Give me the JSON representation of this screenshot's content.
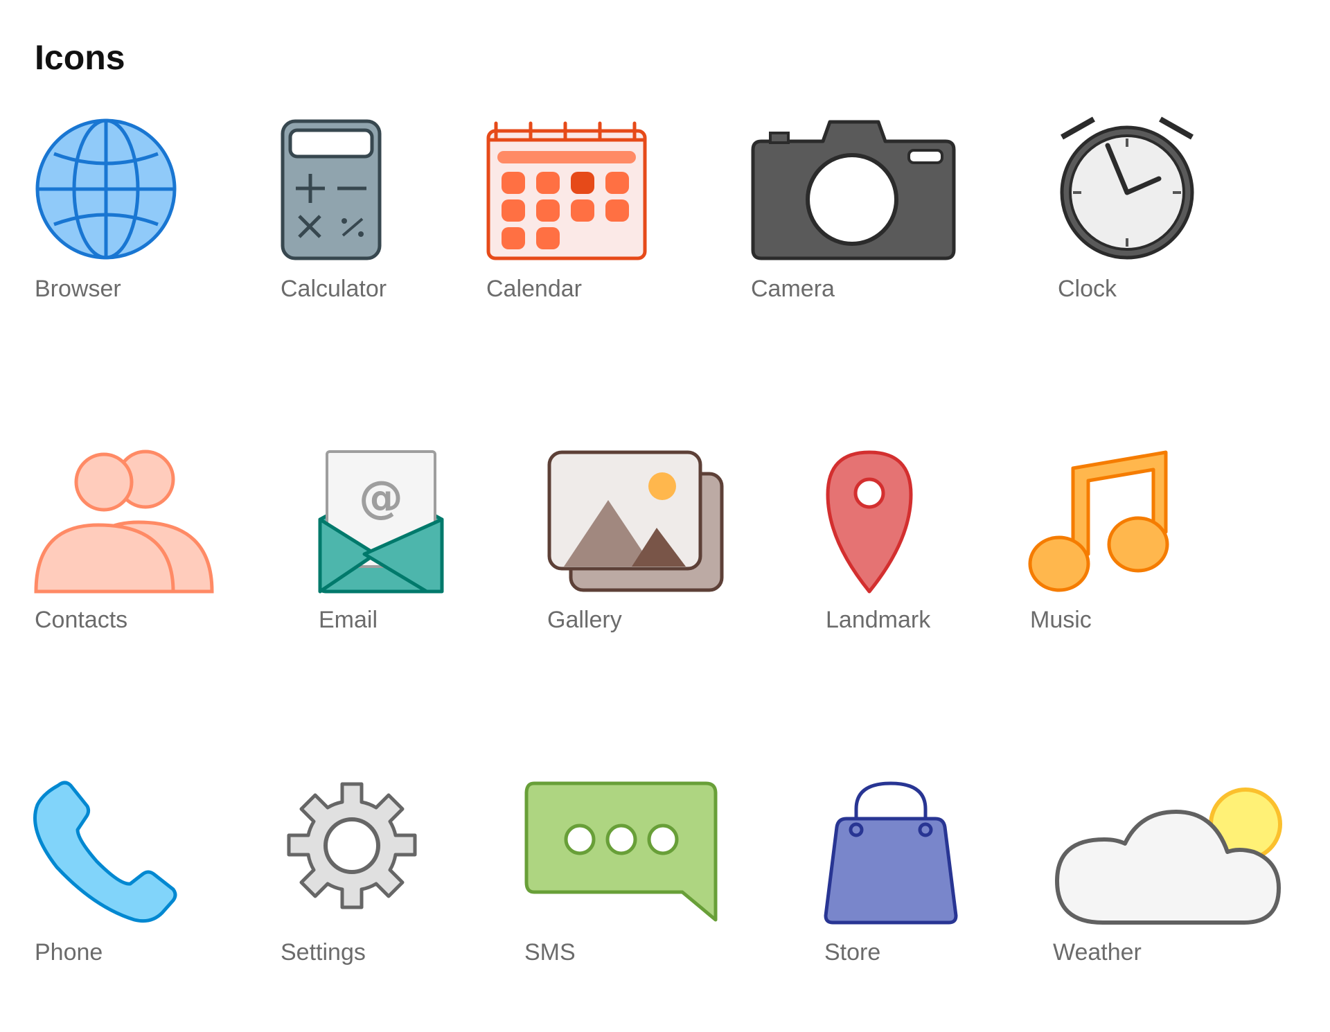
{
  "page": {
    "title": "Icons"
  },
  "icons": [
    {
      "label": "Browser",
      "icon": "globe-icon",
      "color": "#1976d2"
    },
    {
      "label": "Calculator",
      "icon": "calculator-icon",
      "color": "#37474f"
    },
    {
      "label": "Calendar",
      "icon": "calendar-icon",
      "color": "#e64a19"
    },
    {
      "label": "Camera",
      "icon": "camera-icon",
      "color": "#5a5a5a"
    },
    {
      "label": "Clock",
      "icon": "alarm-clock-icon",
      "color": "#3a3a3a"
    },
    {
      "label": "Contacts",
      "icon": "people-icon",
      "color": "#ff8a65"
    },
    {
      "label": "Email",
      "icon": "envelope-icon",
      "color": "#00796b",
      "glyph": "@"
    },
    {
      "label": "Gallery",
      "icon": "picture-icon",
      "color": "#5d4037"
    },
    {
      "label": "Landmark",
      "icon": "map-pin-icon",
      "color": "#d32f2f"
    },
    {
      "label": "Music",
      "icon": "music-note-icon",
      "color": "#f57c00"
    },
    {
      "label": "Phone",
      "icon": "phone-handset-icon",
      "color": "#0288d1"
    },
    {
      "label": "Settings",
      "icon": "gear-icon",
      "color": "#666666"
    },
    {
      "label": "SMS",
      "icon": "chat-bubble-icon",
      "color": "#689f38"
    },
    {
      "label": "Store",
      "icon": "shopping-bag-icon",
      "color": "#283593"
    },
    {
      "label": "Weather",
      "icon": "cloud-sun-icon",
      "color": "#616161"
    }
  ]
}
